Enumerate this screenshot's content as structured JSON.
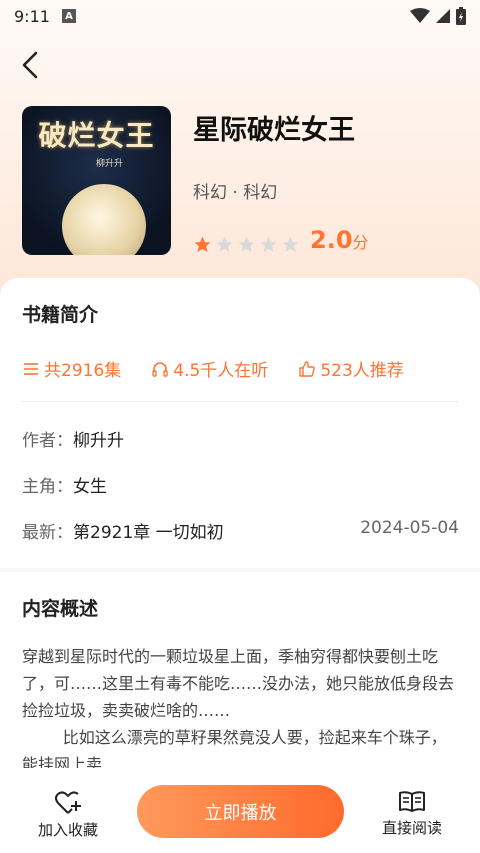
{
  "status_bar": {
    "time": "9:11",
    "notification_icon_letter": "A",
    "icons": [
      "wifi-icon",
      "signal-icon",
      "battery-icon"
    ]
  },
  "nav": {
    "back_icon": "chevron-left-icon"
  },
  "book": {
    "cover_title": "破烂女王",
    "cover_author": "柳升升",
    "title": "星际破烂女王",
    "genre": "科幻 · 科幻",
    "rating_stars": 1,
    "rating_max": 5,
    "score": "2.0",
    "score_unit": "分"
  },
  "intro": {
    "section_title": "书籍简介",
    "stats": {
      "episodes": "共2916集",
      "listeners": "4.5千人在听",
      "recommend": "523人推荐"
    },
    "author_label": "作者：",
    "author_value": "柳升升",
    "protagonist_label": "主角：",
    "protagonist_value": "女生",
    "latest_label": "最新：",
    "latest_value": "第2921章 一切如初",
    "latest_date": "2024-05-04"
  },
  "overview": {
    "section_title": "内容概述",
    "text": "穿越到星际时代的一颗垃圾星上面，季柚穷得都快要刨土吃了，可……这里土有毒不能吃……没办法，她只能放低身段去捡捡垃圾，卖卖破烂啥的……\n        比如这么漂亮的草籽果然竟没人要，捡起来车个珠子，能挂网上卖"
  },
  "bottom": {
    "favorite_label": "加入收藏",
    "play_label": "立即播放",
    "read_label": "直接阅读"
  },
  "colors": {
    "accent": "#ff7433",
    "star_inactive": "#d9d9d9"
  }
}
